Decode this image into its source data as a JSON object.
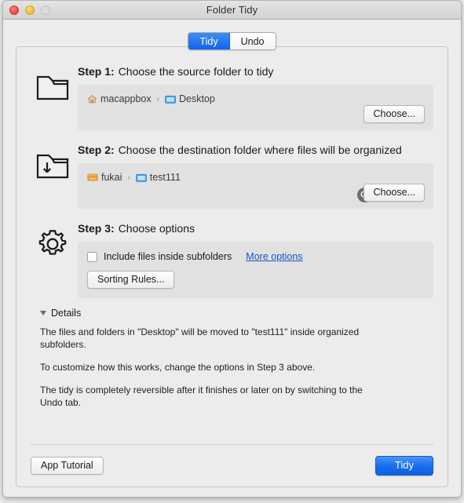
{
  "window": {
    "title": "Folder Tidy",
    "traffic_lights": [
      "close-button",
      "minimize-button",
      "zoom-button"
    ]
  },
  "tabs": [
    {
      "label": "Tidy",
      "active": true
    },
    {
      "label": "Undo",
      "active": false
    }
  ],
  "steps": [
    {
      "number": "Step 1:",
      "title": "Choose the source folder to tidy",
      "icon": "folder-outline-icon",
      "breadcrumb": [
        {
          "label": "macappbox",
          "icon": "home-icon"
        },
        {
          "label": "Desktop",
          "icon": "folder-icon"
        }
      ],
      "choose_label": "Choose...",
      "has_search": false
    },
    {
      "number": "Step 2:",
      "title": "Choose the destination folder where files will be organized",
      "icon": "folder-download-icon",
      "breadcrumb": [
        {
          "label": "fukai",
          "icon": "drive-icon"
        },
        {
          "label": "test111",
          "icon": "folder-icon"
        }
      ],
      "choose_label": "Choose...",
      "has_search": true
    },
    {
      "number": "Step 3:",
      "title": "Choose options",
      "icon": "gear-icon"
    }
  ],
  "options": {
    "checkbox_label": "Include files inside subfolders",
    "checkbox_checked": false,
    "more_options_link": "More options",
    "sorting_rules_label": "Sorting Rules..."
  },
  "details": {
    "header": "Details",
    "expanded": true,
    "paragraphs": [
      "The files and folders in \"Desktop\" will be moved to \"test111\" inside organized subfolders.",
      "To customize how this works, change the options in Step 3 above.",
      "The tidy is completely reversible after it finishes or later on by switching to the Undo tab."
    ]
  },
  "footer": {
    "tutorial_label": "App Tutorial",
    "primary_label": "Tidy"
  },
  "colors": {
    "accent_blue": "#1a6ef0",
    "link_blue": "#1555c8",
    "window_bg": "#ececec",
    "panel_bg": "#e1e1e1",
    "folder_blue": "#4aa3e8",
    "drive_orange": "#f0a63c",
    "close_red": "#ef4b42",
    "min_yellow": "#f7bd3f"
  },
  "separator_arrow": "›"
}
